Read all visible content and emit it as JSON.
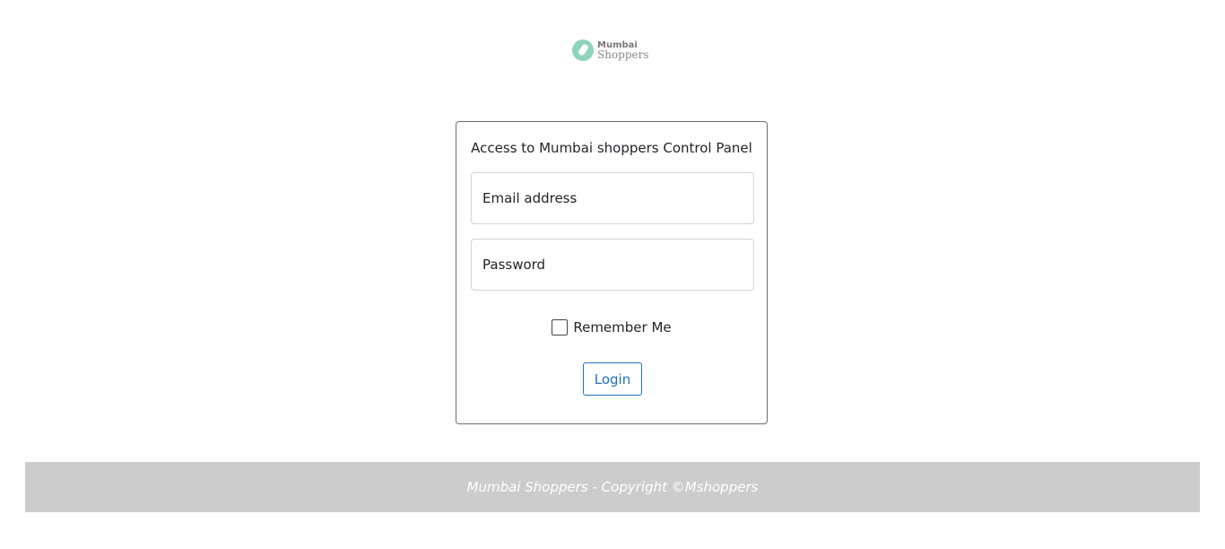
{
  "brand": {
    "logo_line1": "Mumbai",
    "logo_line2": "Shoppers",
    "accent_color": "#8fd3bf"
  },
  "login_form": {
    "title": "Access to Mumbai shoppers Control Panel",
    "email_placeholder": "Email address",
    "password_placeholder": "Password",
    "remember_label": "Remember Me",
    "remember_checked": false,
    "login_label": "Login",
    "button_color": "#1e73be"
  },
  "footer": {
    "text": "Mumbai Shoppers - Copyright ©Mshoppers",
    "background_color": "#cccccc"
  }
}
